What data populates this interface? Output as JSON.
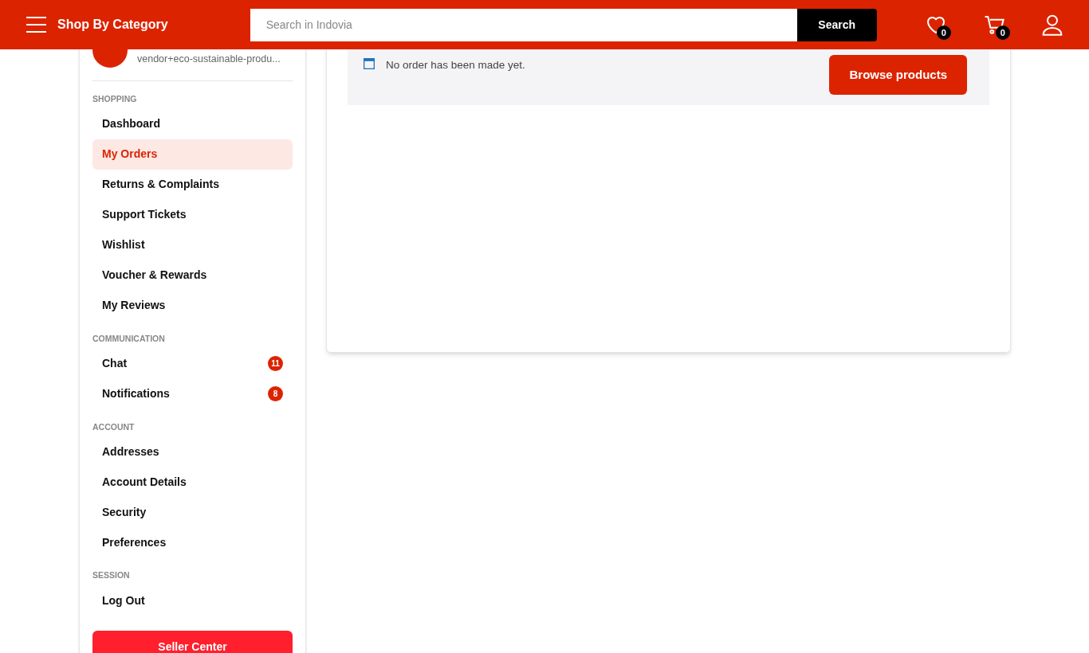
{
  "header": {
    "category_label": "Shop By Category",
    "search": {
      "placeholder": "Search in Indovia",
      "button": "Search"
    },
    "wishlist_count": "0",
    "cart_count": "0"
  },
  "profile": {
    "email": "vendor+eco-sustainable-produ..."
  },
  "sidebar": {
    "sections": [
      {
        "title": "SHOPPING",
        "items": [
          {
            "label": "Dashboard",
            "selected": false
          },
          {
            "label": "My Orders",
            "selected": true
          },
          {
            "label": "Returns & Complaints",
            "selected": false
          },
          {
            "label": "Support Tickets",
            "selected": false
          },
          {
            "label": "Wishlist",
            "selected": false
          },
          {
            "label": "Voucher & Rewards",
            "selected": false
          },
          {
            "label": "My Reviews",
            "selected": false
          }
        ]
      },
      {
        "title": "COMMUNICATION",
        "items": [
          {
            "label": "Chat",
            "selected": false,
            "badge": "11"
          },
          {
            "label": "Notifications",
            "selected": false,
            "badge": "8"
          }
        ]
      },
      {
        "title": "ACCOUNT",
        "items": [
          {
            "label": "Addresses",
            "selected": false
          },
          {
            "label": "Account Details",
            "selected": false
          },
          {
            "label": "Security",
            "selected": false
          },
          {
            "label": "Preferences",
            "selected": false
          }
        ]
      },
      {
        "title": "SESSION",
        "items": [
          {
            "label": "Log Out",
            "selected": false
          }
        ]
      }
    ],
    "seller_button": "Seller Center"
  },
  "orders": {
    "notice": "No order has been made yet.",
    "button": "Browse products"
  }
}
